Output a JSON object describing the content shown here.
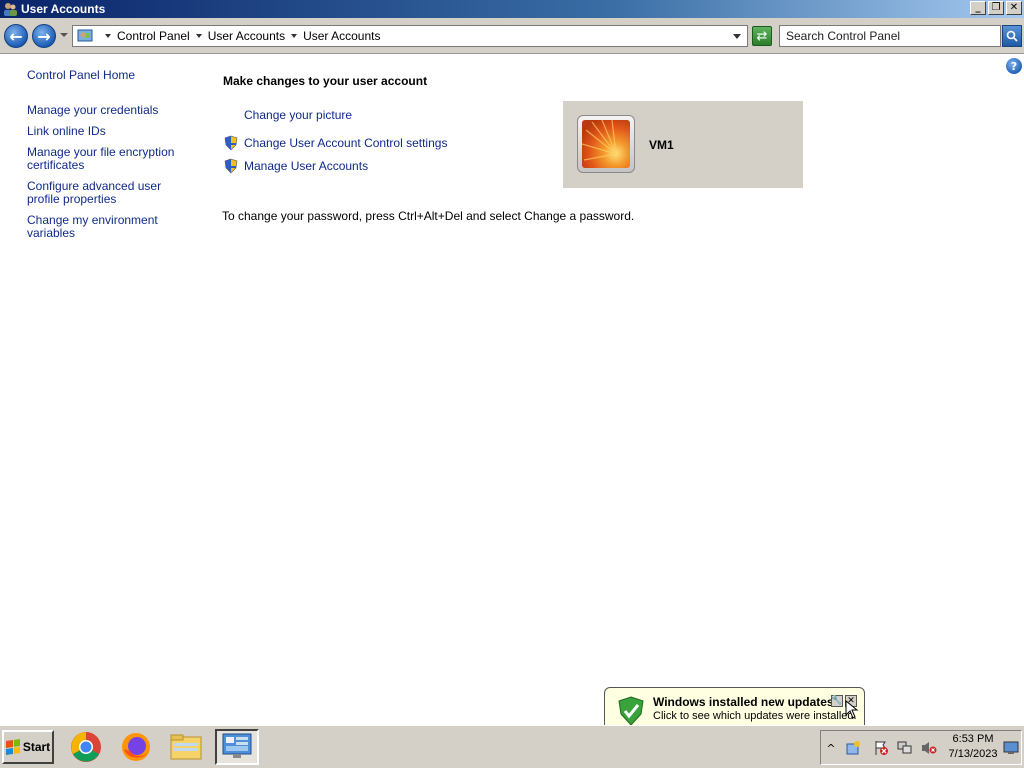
{
  "window": {
    "title": "User Accounts"
  },
  "title_controls": {
    "minimize": "_",
    "restore": "❐",
    "close": "✕"
  },
  "address": {
    "crumbs": [
      "Control Panel",
      "User Accounts",
      "User Accounts"
    ],
    "search_placeholder": "Search Control Panel"
  },
  "sidebar": {
    "items": [
      "Control Panel Home",
      "Manage your credentials",
      "Link online IDs",
      "Manage your file encryption certificates",
      "Configure advanced user profile properties",
      "Change my environment variables"
    ]
  },
  "main": {
    "heading": "Make changes to your user account",
    "tasks": [
      "Change your picture",
      "Change User Account Control settings",
      "Manage User Accounts"
    ],
    "password_hint": "To change your password, press Ctrl+Alt+Del and select Change a password."
  },
  "user": {
    "name": "VM1"
  },
  "notification": {
    "title": "Windows installed new updates",
    "body": "Click to see which updates were installed."
  },
  "taskbar": {
    "start_label": "Start",
    "apps": [
      "chrome-icon",
      "firefox-icon",
      "file-explorer-icon",
      "control-panel-icon"
    ]
  },
  "clock": {
    "time": "6:53 PM",
    "date": "7/13/2023"
  },
  "colors": {
    "link": "#102a8a",
    "title_bar": "#0a246a",
    "chrome": "#d4d0c8",
    "balloon": "#ffffe1"
  }
}
